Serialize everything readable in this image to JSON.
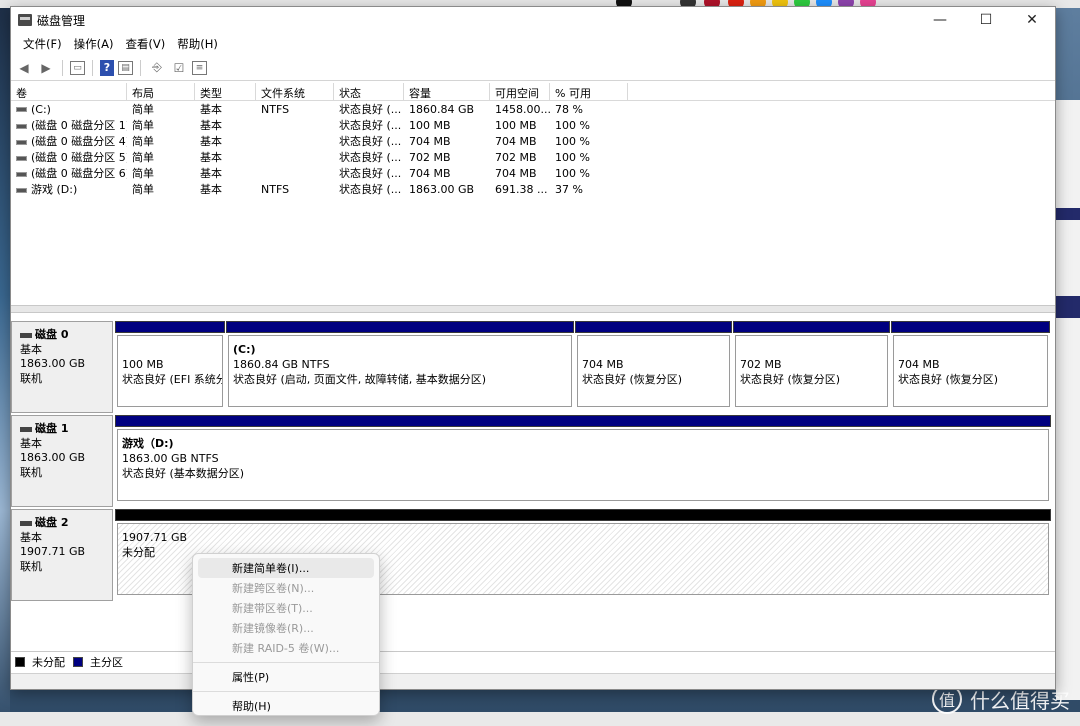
{
  "window": {
    "title": "磁盘管理"
  },
  "menu": [
    "文件(F)",
    "操作(A)",
    "查看(V)",
    "帮助(H)"
  ],
  "volume_list": {
    "columns": [
      "卷",
      "布局",
      "类型",
      "文件系统",
      "状态",
      "容量",
      "可用空间",
      "% 可用"
    ],
    "rows": [
      [
        "(C:)",
        "简单",
        "基本",
        "NTFS",
        "状态良好 (...",
        "1860.84 GB",
        "1458.00...",
        "78 %"
      ],
      [
        "(磁盘 0 磁盘分区 1)",
        "简单",
        "基本",
        "",
        "状态良好 (...",
        "100 MB",
        "100 MB",
        "100 %"
      ],
      [
        "(磁盘 0 磁盘分区 4)",
        "简单",
        "基本",
        "",
        "状态良好 (...",
        "704 MB",
        "704 MB",
        "100 %"
      ],
      [
        "(磁盘 0 磁盘分区 5)",
        "简单",
        "基本",
        "",
        "状态良好 (...",
        "702 MB",
        "702 MB",
        "100 %"
      ],
      [
        "(磁盘 0 磁盘分区 6)",
        "简单",
        "基本",
        "",
        "状态良好 (...",
        "704 MB",
        "704 MB",
        "100 %"
      ],
      [
        "游戏 (D:)",
        "简单",
        "基本",
        "NTFS",
        "状态良好 (...",
        "1863.00 GB",
        "691.38 ...",
        "37 %"
      ]
    ]
  },
  "disks": [
    {
      "name": "磁盘 0",
      "type": "基本",
      "size": "1863.00 GB",
      "status": "联机",
      "partitions": [
        {
          "title": "",
          "size": "100 MB",
          "status": "状态良好 (EFI 系统分"
        },
        {
          "title": "(C:)",
          "size": "1860.84 GB NTFS",
          "status": "状态良好 (启动, 页面文件, 故障转储, 基本数据分区)"
        },
        {
          "title": "",
          "size": "704 MB",
          "status": "状态良好 (恢复分区)"
        },
        {
          "title": "",
          "size": "702 MB",
          "status": "状态良好 (恢复分区)"
        },
        {
          "title": "",
          "size": "704 MB",
          "status": "状态良好 (恢复分区)"
        }
      ]
    },
    {
      "name": "磁盘 1",
      "type": "基本",
      "size": "1863.00 GB",
      "status": "联机",
      "partitions": [
        {
          "title": "游戏（D:)",
          "size": "1863.00 GB NTFS",
          "status": "状态良好 (基本数据分区)"
        }
      ]
    },
    {
      "name": "磁盘 2",
      "type": "基本",
      "size": "1907.71 GB",
      "status": "联机",
      "partitions": [
        {
          "title": "",
          "size": "1907.71 GB",
          "status": "未分配"
        }
      ]
    }
  ],
  "legend": {
    "unallocated": "未分配",
    "primary": "主分区"
  },
  "colors": {
    "primary_partition": "#000080",
    "unallocated": "#000000"
  },
  "context_menu": {
    "new_simple": "新建简单卷(I)...",
    "new_spanned": "新建跨区卷(N)...",
    "new_striped": "新建带区卷(T)...",
    "new_mirrored": "新建镜像卷(R)...",
    "new_raid5": "新建 RAID-5 卷(W)...",
    "properties": "属性(P)",
    "help": "帮助(H)"
  },
  "watermark": {
    "text": "什么值得买",
    "logo": "值"
  }
}
